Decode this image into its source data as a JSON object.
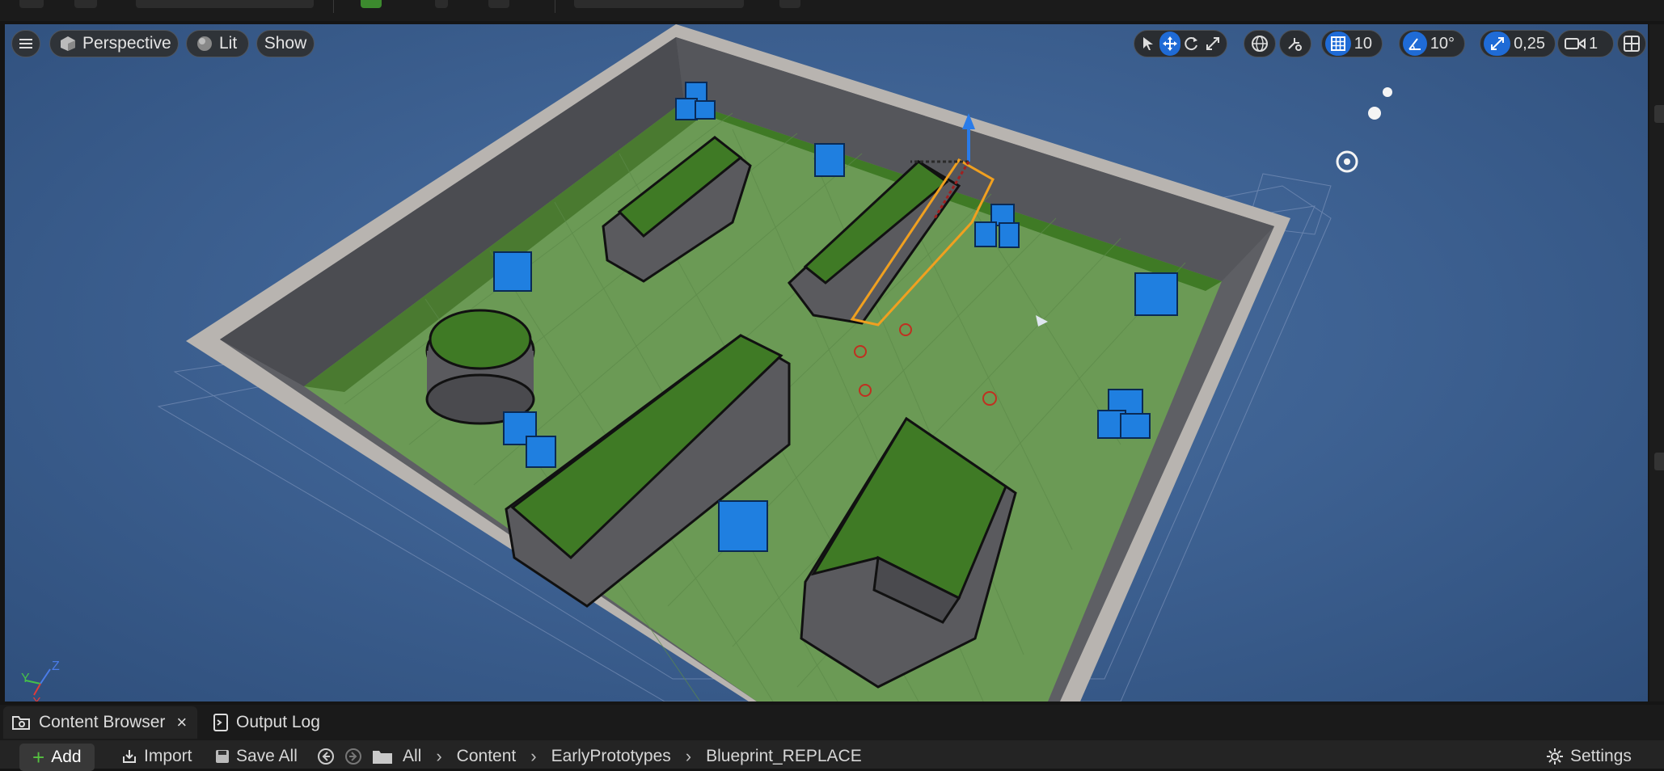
{
  "viewport": {
    "menu_icon": "hamburger-icon",
    "perspective_label": "Perspective",
    "lit_label": "Lit",
    "show_label": "Show",
    "grid_snap_value": "10",
    "rotation_snap_value": "10°",
    "scale_snap_value": "0,25",
    "camera_speed_value": "1",
    "axis_labels": {
      "y": "Y",
      "z": "Z",
      "x": "X"
    }
  },
  "bottom_tabs": {
    "content_browser": "Content Browser",
    "close_symbol": "×",
    "output_log": "Output Log"
  },
  "content_toolbar": {
    "add_label": "Add",
    "import_label": "Import",
    "save_all_label": "Save All",
    "breadcrumb": [
      "All",
      "Content",
      "EarlyPrototypes",
      "Blueprint_REPLACE"
    ],
    "settings_label": "Settings"
  },
  "colors": {
    "accent": "#1f6bd6",
    "floor": "#6b9a55",
    "wall": "#6f6f73",
    "cube": "#1f7fe0",
    "selection": "#f0a020",
    "sky": "#3e6293"
  }
}
